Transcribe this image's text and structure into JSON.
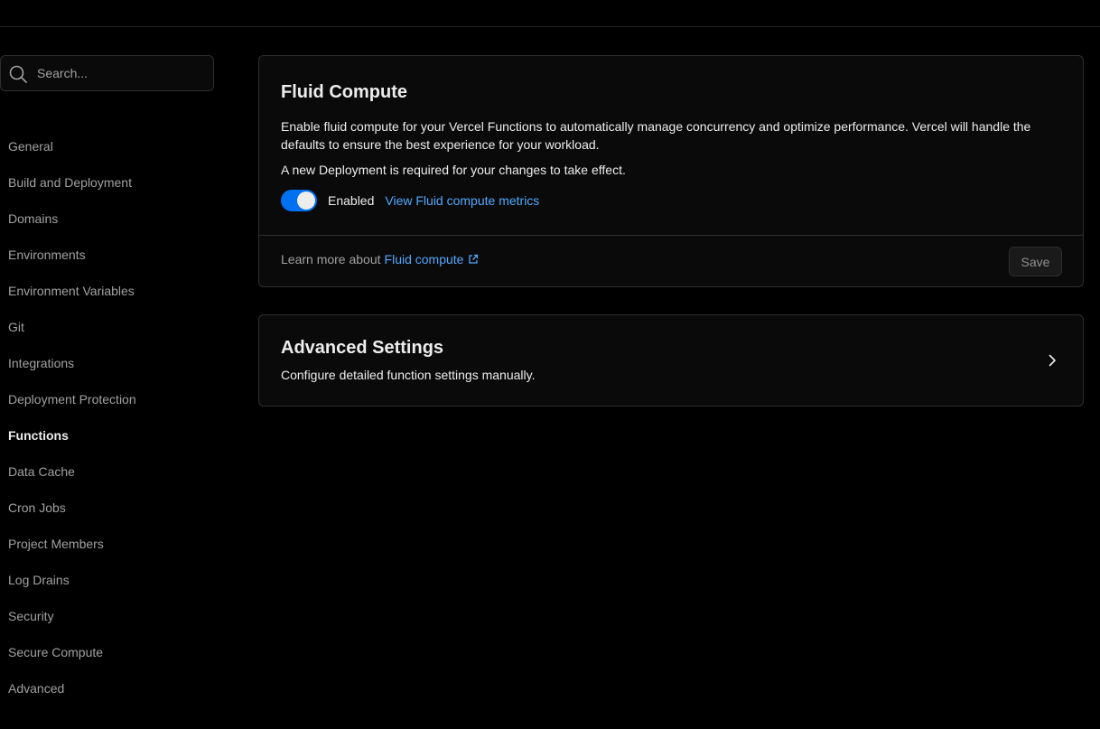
{
  "search": {
    "placeholder": "Search..."
  },
  "sidebar": {
    "items": [
      {
        "label": "General"
      },
      {
        "label": "Build and Deployment"
      },
      {
        "label": "Domains"
      },
      {
        "label": "Environments"
      },
      {
        "label": "Environment Variables"
      },
      {
        "label": "Git"
      },
      {
        "label": "Integrations"
      },
      {
        "label": "Deployment Protection"
      },
      {
        "label": "Functions",
        "active": true
      },
      {
        "label": "Data Cache"
      },
      {
        "label": "Cron Jobs"
      },
      {
        "label": "Project Members"
      },
      {
        "label": "Log Drains"
      },
      {
        "label": "Security"
      },
      {
        "label": "Secure Compute"
      },
      {
        "label": "Advanced"
      }
    ]
  },
  "fluid_compute": {
    "title": "Fluid Compute",
    "description": "Enable fluid compute for your Vercel Functions to automatically manage concurrency and optimize performance. Vercel will handle the defaults to ensure the best experience for your workload.",
    "notice": "A new Deployment is required for your changes to take effect.",
    "toggle_state": "on",
    "toggle_label": "Enabled",
    "metrics_link": "View Fluid compute metrics",
    "footer_text": "Learn more about",
    "footer_link": "Fluid compute",
    "save_label": "Save"
  },
  "advanced_settings": {
    "title": "Advanced Settings",
    "description": "Configure detailed function settings manually."
  },
  "colors": {
    "background": "#000000",
    "card": "#0a0a0a",
    "border": "#2e2e2e",
    "accent": "#0070f3",
    "link": "#52a8ff"
  },
  "icons": [
    "search-icon",
    "external-link-icon",
    "chevron-right-icon"
  ]
}
